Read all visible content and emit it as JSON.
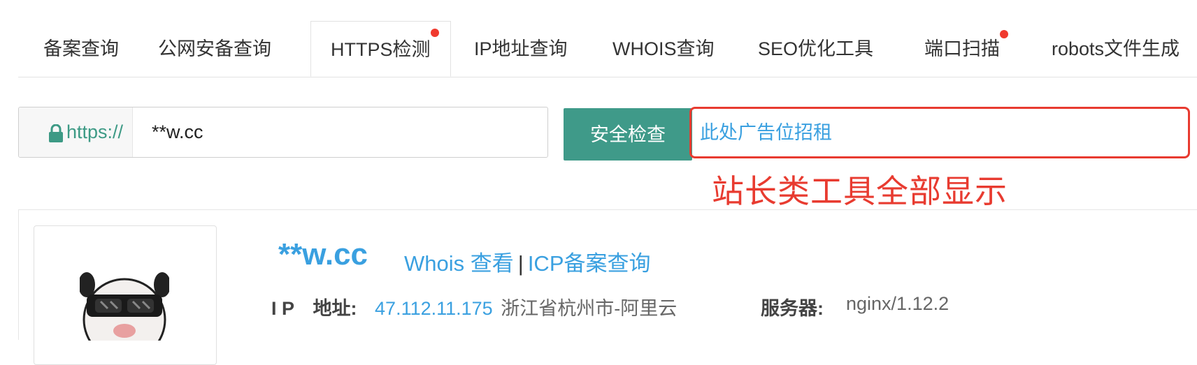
{
  "tabs": [
    {
      "label": "备案查询"
    },
    {
      "label": "公网安备查询"
    },
    {
      "label": "HTTPS检测",
      "badge": true
    },
    {
      "label": "IP地址查询"
    },
    {
      "label": "WHOIS查询"
    },
    {
      "label": "SEO优化工具"
    },
    {
      "label": "端口扫描",
      "badge": true
    },
    {
      "label": "robots文件生成"
    }
  ],
  "active_tab": "HTTPS检测",
  "search": {
    "prefix": "https://",
    "value": "**w.cc",
    "button_label": "安全检查"
  },
  "ad": {
    "text": "此处广告位招租"
  },
  "annotation": "站长类工具全部显示",
  "result": {
    "domain": "**w.cc",
    "whois_link": "Whois 查看",
    "separator": "|",
    "icp_link": "ICP备案查询",
    "ip_label": "I P　地址:",
    "ip_value": "47.112.11.175",
    "ip_location": "浙江省杭州市-阿里云",
    "server_label": "服务器:",
    "server_value": "nginx/1.12.2"
  },
  "colors": {
    "accent": "#3f9a89",
    "link": "#3aa0e0",
    "badge": "#f03a2e",
    "annotation": "#e83b30"
  },
  "icons": [
    "lock-icon",
    "favicon-avatar"
  ]
}
